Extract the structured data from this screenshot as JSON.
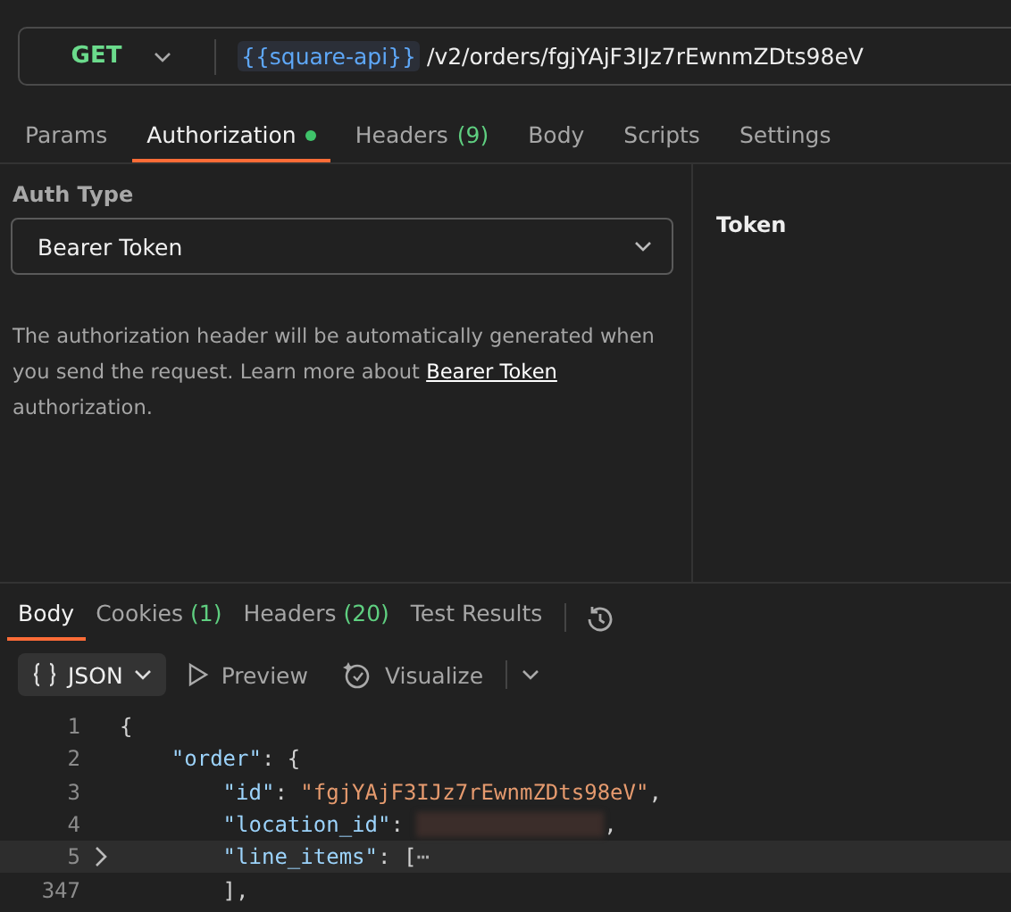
{
  "request": {
    "method": "GET",
    "variable": "{{square-api}}",
    "path": "/v2/orders/fgjYAjF3IJz7rEwnmZDts98eV"
  },
  "request_tabs": [
    {
      "label": "Params",
      "selected": false,
      "dot": false
    },
    {
      "label": "Authorization",
      "selected": true,
      "dot": true
    },
    {
      "label": "Headers",
      "count": "(9)",
      "selected": false,
      "dot": false
    },
    {
      "label": "Body",
      "selected": false,
      "dot": false
    },
    {
      "label": "Scripts",
      "selected": false,
      "dot": false
    },
    {
      "label": "Settings",
      "selected": false,
      "dot": false
    }
  ],
  "auth": {
    "type_label": "Auth Type",
    "type": "Bearer Token",
    "description_before": "The authorization header will be automatically generated when you send the request. Learn more about ",
    "link": "Bearer Token",
    "description_after": " authorization.",
    "token_label": "Token"
  },
  "response_tabs": [
    {
      "label": "Body",
      "selected": true
    },
    {
      "label": "Cookies",
      "count": "(1)",
      "selected": false
    },
    {
      "label": "Headers",
      "count": "(20)",
      "selected": false
    },
    {
      "label": "Test Results",
      "selected": false
    }
  ],
  "response_toolbar": {
    "format": "JSON",
    "buttons": [
      {
        "kind": "preview",
        "label": "Preview"
      },
      {
        "kind": "visualize",
        "label": "Visualize"
      }
    ]
  },
  "code_lines": [
    {
      "number": "1",
      "collapsed": false,
      "highlighted": false,
      "tokens": [
        {
          "kind": "punct",
          "text": "{"
        }
      ]
    },
    {
      "number": "2",
      "collapsed": false,
      "highlighted": false,
      "tokens": [
        {
          "kind": "key",
          "text": "    \"order\""
        },
        {
          "kind": "punct",
          "text": ": {"
        }
      ]
    },
    {
      "number": "3",
      "collapsed": false,
      "highlighted": false,
      "tokens": [
        {
          "kind": "key",
          "text": "        \"id\""
        },
        {
          "kind": "punct",
          "text": ": "
        },
        {
          "kind": "string",
          "text": "\"fgjYAjF3IJz7rEwnmZDts98eV\""
        },
        {
          "kind": "punct",
          "text": ","
        }
      ]
    },
    {
      "number": "4",
      "collapsed": false,
      "highlighted": false,
      "tokens": [
        {
          "kind": "key",
          "text": "        \"location_id\""
        },
        {
          "kind": "punct",
          "text": ": "
        },
        {
          "kind": "redacted"
        },
        {
          "kind": "punct",
          "text": ","
        }
      ]
    },
    {
      "number": "5",
      "collapsed": true,
      "highlighted": true,
      "tokens": [
        {
          "kind": "key",
          "text": "        \"line_items\""
        },
        {
          "kind": "punct",
          "text": ": ["
        },
        {
          "kind": "fold",
          "text": "⋯"
        }
      ]
    },
    {
      "number": "347",
      "collapsed": false,
      "highlighted": false,
      "tokens": [
        {
          "kind": "punct",
          "text": "        ],"
        }
      ]
    }
  ]
}
